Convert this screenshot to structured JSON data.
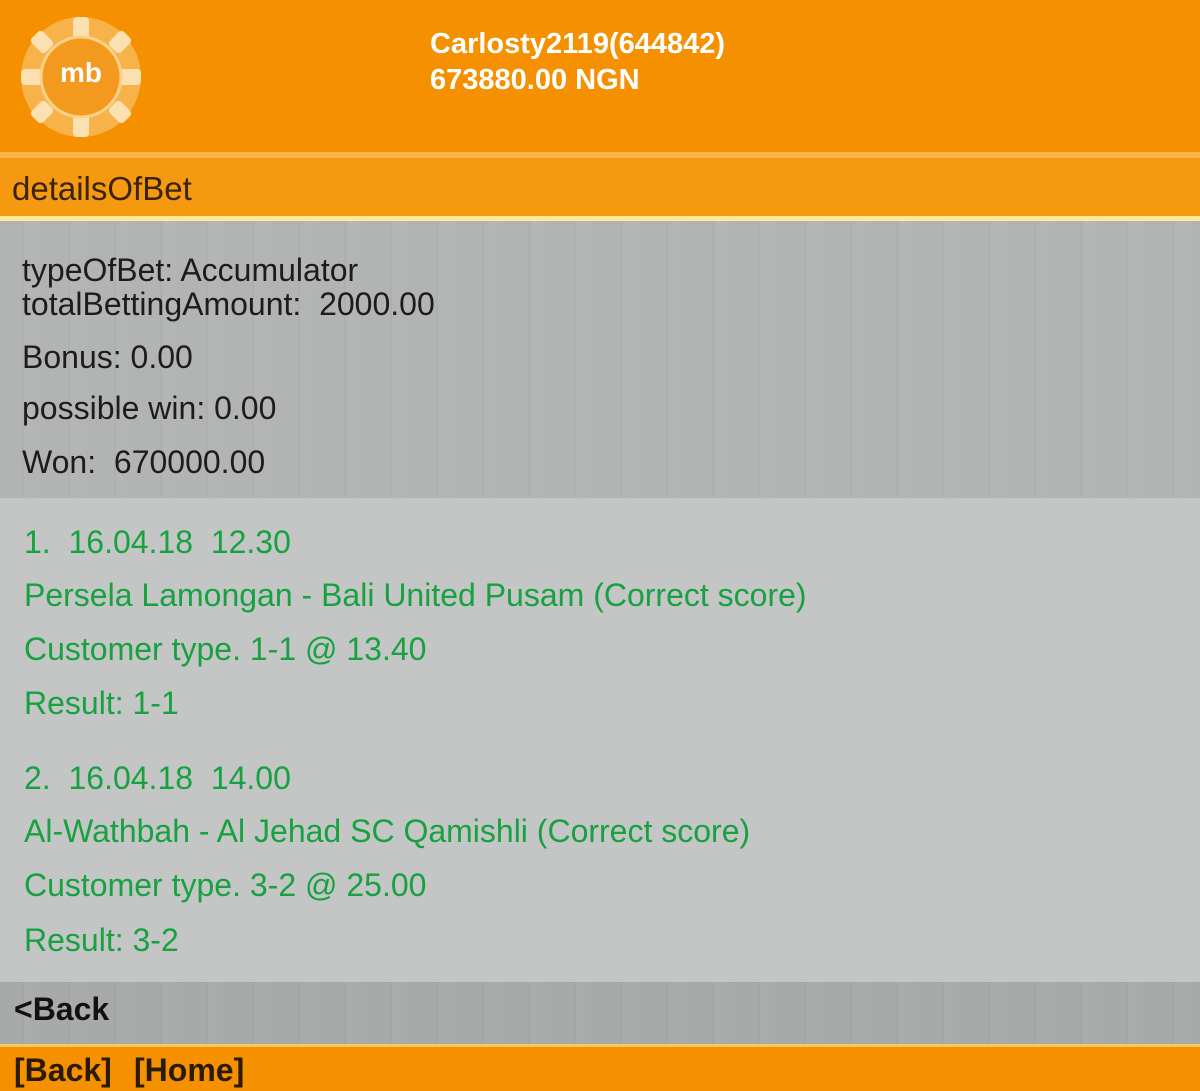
{
  "header": {
    "logo_text": "mb",
    "username": "Carlosty2119(644842)",
    "balance": "673880.00 NGN"
  },
  "title": "detailsOfBet",
  "summary": {
    "type_of_bet": "typeOfBet: Accumulator",
    "total_betting_amount": "totalBettingAmount:  2000.00",
    "bonus": "Bonus: 0.00",
    "possible_win": "possible win: 0.00",
    "won": "Won:  670000.00"
  },
  "bets": [
    {
      "heading": "1.  16.04.18  12.30",
      "match": "Persela Lamongan - Bali United Pusam (Correct score)",
      "customer_type": "Customer type. 1-1 @ 13.40",
      "result": "Result: 1-1"
    },
    {
      "heading": "2.  16.04.18  14.00",
      "match": "Al-Wathbah - Al Jehad SC Qamishli (Correct score)",
      "customer_type": "Customer type. 3-2 @ 25.00",
      "result": "Result: 3-2"
    }
  ],
  "nav": {
    "back": "<Back",
    "footer_back": "[Back]",
    "footer_home": "[Home]"
  },
  "colors": {
    "brand_orange": "#f59100",
    "bet_text_green": "#17a140"
  }
}
